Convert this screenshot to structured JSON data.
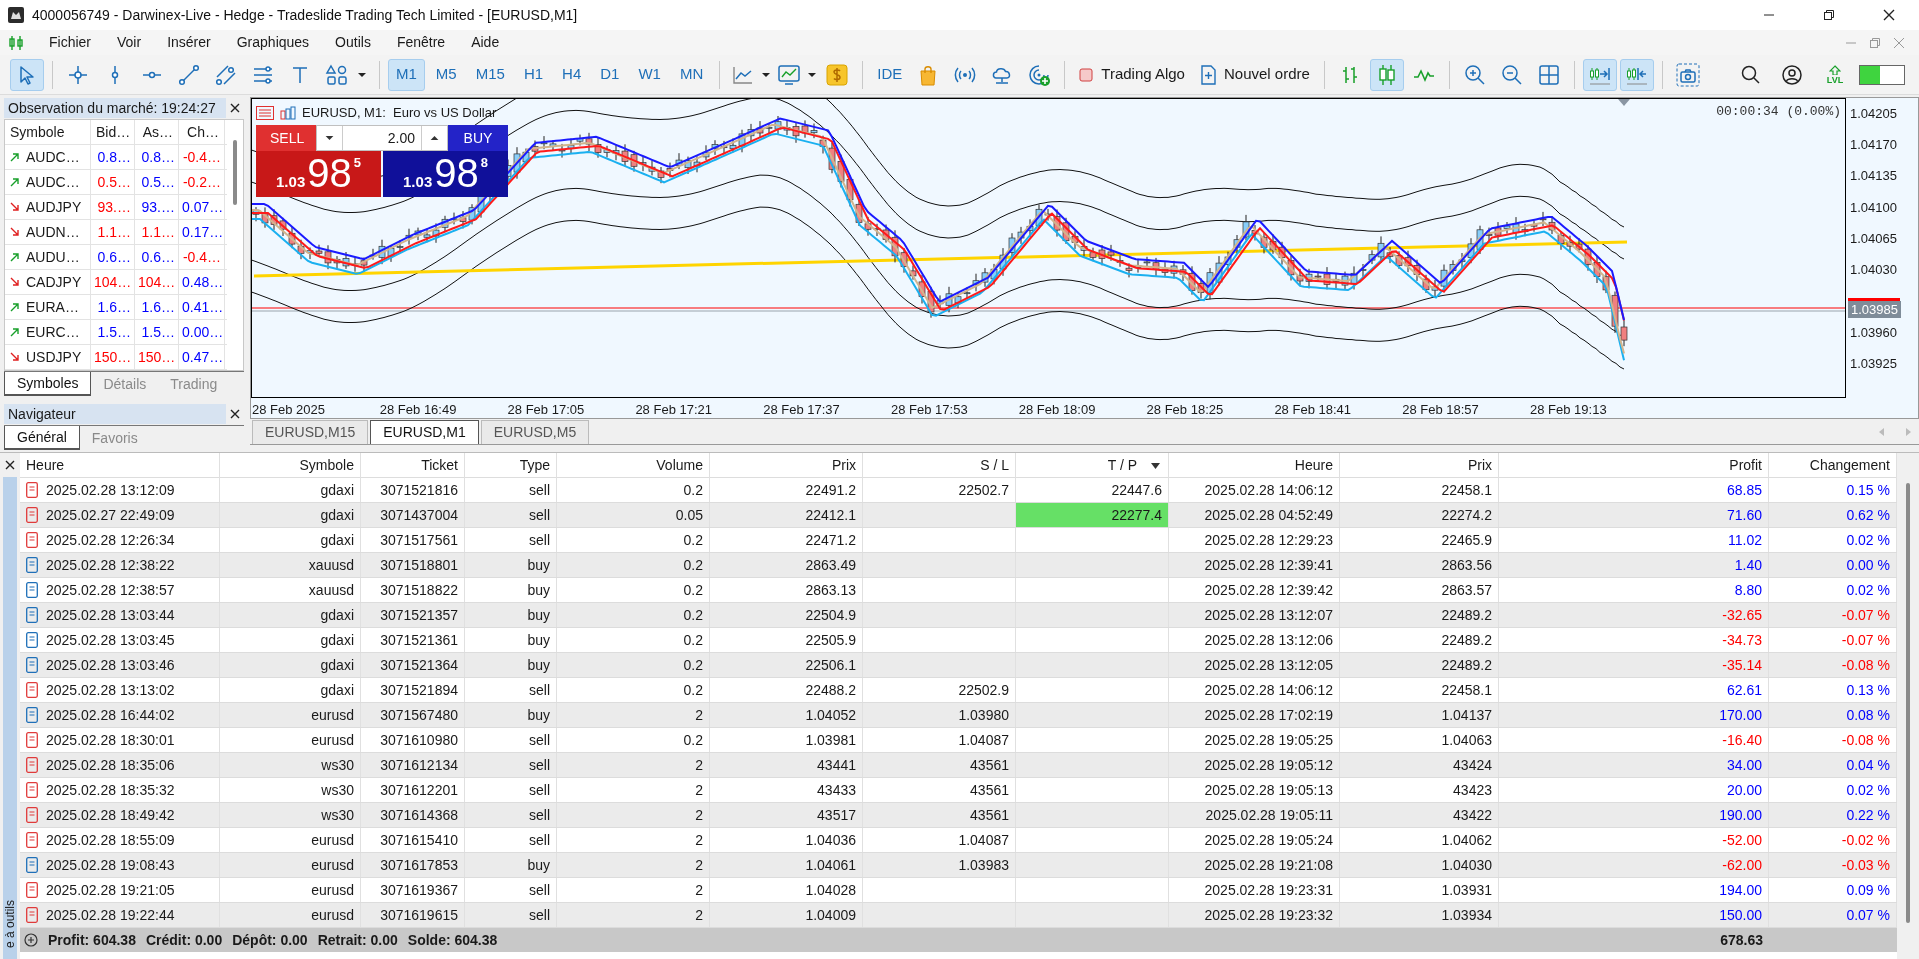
{
  "window": {
    "title": "4000056749 - Darwinex-Live - Hedge - Tradeslide Trading Tech Limited - [EURUSD,M1]"
  },
  "menu": [
    "Fichier",
    "Voir",
    "Insérer",
    "Graphiques",
    "Outils",
    "Fenêtre",
    "Aide"
  ],
  "toolbar": {
    "drawing_tools": [
      {
        "selected": true
      },
      {
        "selected": false
      },
      {
        "selected": false
      },
      {
        "selected": false
      },
      {
        "selected": false
      },
      {
        "selected": false
      },
      {
        "selected": false
      },
      {
        "selected": false
      },
      {
        "selected": false
      }
    ],
    "timeframes": [
      {
        "label": "M1",
        "selected": true
      },
      {
        "label": "M5",
        "selected": false
      },
      {
        "label": "M15",
        "selected": false
      },
      {
        "label": "H1",
        "selected": false
      },
      {
        "label": "H4",
        "selected": false
      },
      {
        "label": "D1",
        "selected": false
      },
      {
        "label": "W1",
        "selected": false
      },
      {
        "label": "MN",
        "selected": false
      }
    ],
    "ide_label": "IDE",
    "algo_trading": {
      "label": "Trading Algo",
      "on": false
    },
    "new_order_label": "Nouvel ordre",
    "chart_types": [
      {
        "selected": false
      },
      {
        "selected": true
      },
      {
        "selected": false
      }
    ],
    "chart_options": [
      {
        "selected": true
      },
      {
        "selected": true
      }
    ],
    "level_label": "LVL",
    "meter": {
      "level": 0.45
    }
  },
  "market_watch": {
    "title": "Observation du marché: 19:24:27",
    "columns": [
      "Symbole",
      "Bid…",
      "As…",
      "Ch…"
    ],
    "rows": [
      {
        "kind": "up",
        "symbol": "AUDC…",
        "bid": {
          "text": "0.8…",
          "color": "#0000ff"
        },
        "ask": {
          "text": "0.8…",
          "color": "#0000ff"
        },
        "change": {
          "text": "-0.4…",
          "color": "#ff0000"
        }
      },
      {
        "kind": "up",
        "symbol": "AUDC…",
        "bid": {
          "text": "0.5…",
          "color": "#ff0000"
        },
        "ask": {
          "text": "0.5…",
          "color": "#0000ff"
        },
        "change": {
          "text": "-0.2…",
          "color": "#ff0000"
        }
      },
      {
        "kind": "down",
        "symbol": "AUDJPY",
        "bid": {
          "text": "93.…",
          "color": "#ff0000"
        },
        "ask": {
          "text": "93.…",
          "color": "#0000ff"
        },
        "change": {
          "text": "0.07…",
          "color": "#0000ff"
        }
      },
      {
        "kind": "down",
        "symbol": "AUDN…",
        "bid": {
          "text": "1.1…",
          "color": "#ff0000"
        },
        "ask": {
          "text": "1.1…",
          "color": "#ff0000"
        },
        "change": {
          "text": "0.17…",
          "color": "#0000ff"
        }
      },
      {
        "kind": "up",
        "symbol": "AUDU…",
        "bid": {
          "text": "0.6…",
          "color": "#0000ff"
        },
        "ask": {
          "text": "0.6…",
          "color": "#0000ff"
        },
        "change": {
          "text": "-0.4…",
          "color": "#ff0000"
        }
      },
      {
        "kind": "down",
        "symbol": "CADJPY",
        "bid": {
          "text": "104…",
          "color": "#ff0000"
        },
        "ask": {
          "text": "104…",
          "color": "#ff0000"
        },
        "change": {
          "text": "0.48…",
          "color": "#0000ff"
        }
      },
      {
        "kind": "up",
        "symbol": "EURA…",
        "bid": {
          "text": "1.6…",
          "color": "#0000ff"
        },
        "ask": {
          "text": "1.6…",
          "color": "#0000ff"
        },
        "change": {
          "text": "0.41…",
          "color": "#0000ff"
        }
      },
      {
        "kind": "up",
        "symbol": "EURC…",
        "bid": {
          "text": "1.5…",
          "color": "#0000ff"
        },
        "ask": {
          "text": "1.5…",
          "color": "#0000ff"
        },
        "change": {
          "text": "0.00…",
          "color": "#0000ff"
        }
      },
      {
        "kind": "down",
        "symbol": "USDJPY",
        "bid": {
          "text": "150…",
          "color": "#ff0000"
        },
        "ask": {
          "text": "150…",
          "color": "#ff0000"
        },
        "change": {
          "text": "0.47…",
          "color": "#0000ff"
        }
      }
    ],
    "tabs": [
      {
        "label": "Symboles",
        "selected": true
      },
      {
        "label": "Détails",
        "selected": false
      },
      {
        "label": "Trading",
        "selected": false
      }
    ]
  },
  "navigator": {
    "title": "Navigateur",
    "tabs": [
      {
        "label": "Général",
        "selected": true
      },
      {
        "label": "Favoris",
        "selected": false
      }
    ]
  },
  "chart": {
    "header": "EURUSD, M1:  Euro vs US Dollar",
    "one_click": {
      "sell_label": "SELL",
      "buy_label": "BUY",
      "volume": "2.00",
      "sell_price": {
        "prefix": "1.03",
        "main": "98",
        "suffix": "5"
      },
      "buy_price": {
        "prefix": "1.03",
        "main": "98",
        "suffix": "8"
      }
    },
    "timer": "00:00:34 (0.00%)",
    "price_labels": [
      "1.04205",
      "1.04170",
      "1.04135",
      "1.04100",
      "1.04065",
      "1.04030",
      "1.03960",
      "1.03925"
    ],
    "current_price": "1.03985",
    "time_labels": [
      "28 Feb 2025",
      "28 Feb 16:49",
      "28 Feb 17:05",
      "28 Feb 17:21",
      "28 Feb 17:37",
      "28 Feb 17:53",
      "28 Feb 18:09",
      "28 Feb 18:25",
      "28 Feb 18:41",
      "28 Feb 18:57",
      "28 Feb 19:13"
    ]
  },
  "chart_tabs": [
    {
      "label": "EURUSD,M15",
      "selected": false
    },
    {
      "label": "EURUSD,M1",
      "selected": true
    },
    {
      "label": "EURUSD,M5",
      "selected": false
    }
  ],
  "table": {
    "columns": [
      {
        "label": "Heure",
        "sorted": false
      },
      {
        "label": "Symbole",
        "sorted": false
      },
      {
        "label": "Ticket",
        "sorted": false
      },
      {
        "label": "Type",
        "sorted": false
      },
      {
        "label": "Volume",
        "sorted": false
      },
      {
        "label": "Prix",
        "sorted": false
      },
      {
        "label": "S / L",
        "sorted": false
      },
      {
        "label": "T / P",
        "sorted": true
      },
      {
        "label": "Heure",
        "sorted": false
      },
      {
        "label": "Prix",
        "sorted": false
      },
      {
        "label": "Profit",
        "sorted": false
      },
      {
        "label": "Changement",
        "sorted": false
      }
    ],
    "rows": [
      {
        "kind": "sell",
        "open_time": "2025.02.28 13:12:09",
        "symbol": "gdaxi",
        "ticket": "3071521816",
        "type": "sell",
        "volume": "0.2",
        "open_price": "22491.2",
        "sl": "22502.7",
        "tp": "22447.6",
        "tp_hit": false,
        "close_time": "2025.02.28 14:06:12",
        "close_price": "22458.1",
        "profit": "68.85",
        "change": "0.15 %",
        "color": "#0000ff"
      },
      {
        "kind": "sell",
        "open_time": "2025.02.27 22:49:09",
        "symbol": "gdaxi",
        "ticket": "3071437004",
        "type": "sell",
        "volume": "0.05",
        "open_price": "22412.1",
        "tp": "22277.4",
        "tp_hit": true,
        "close_time": "2025.02.28 04:52:49",
        "close_price": "22274.2",
        "profit": "71.60",
        "change": "0.62 %",
        "color": "#0000ff"
      },
      {
        "kind": "sell",
        "open_time": "2025.02.28 12:26:34",
        "symbol": "gdaxi",
        "ticket": "3071517561",
        "type": "sell",
        "volume": "0.2",
        "open_price": "22471.2",
        "tp_hit": false,
        "close_time": "2025.02.28 12:29:23",
        "close_price": "22465.9",
        "profit": "11.02",
        "change": "0.02 %",
        "color": "#0000ff"
      },
      {
        "kind": "buy",
        "open_time": "2025.02.28 12:38:22",
        "symbol": "xauusd",
        "ticket": "3071518801",
        "type": "buy",
        "volume": "0.2",
        "open_price": "2863.49",
        "tp_hit": false,
        "close_time": "2025.02.28 12:39:41",
        "close_price": "2863.56",
        "profit": "1.40",
        "change": "0.00 %",
        "color": "#0000ff"
      },
      {
        "kind": "buy",
        "open_time": "2025.02.28 12:38:57",
        "symbol": "xauusd",
        "ticket": "3071518822",
        "type": "buy",
        "volume": "0.2",
        "open_price": "2863.13",
        "tp_hit": false,
        "close_time": "2025.02.28 12:39:42",
        "close_price": "2863.57",
        "profit": "8.80",
        "change": "0.02 %",
        "color": "#0000ff"
      },
      {
        "kind": "buy",
        "open_time": "2025.02.28 13:03:44",
        "symbol": "gdaxi",
        "ticket": "3071521357",
        "type": "buy",
        "volume": "0.2",
        "open_price": "22504.9",
        "tp_hit": false,
        "close_time": "2025.02.28 13:12:07",
        "close_price": "22489.2",
        "profit": "-32.65",
        "change": "-0.07 %",
        "color": "#ff0000"
      },
      {
        "kind": "buy",
        "open_time": "2025.02.28 13:03:45",
        "symbol": "gdaxi",
        "ticket": "3071521361",
        "type": "buy",
        "volume": "0.2",
        "open_price": "22505.9",
        "tp_hit": false,
        "close_time": "2025.02.28 13:12:06",
        "close_price": "22489.2",
        "profit": "-34.73",
        "change": "-0.07 %",
        "color": "#ff0000"
      },
      {
        "kind": "buy",
        "open_time": "2025.02.28 13:03:46",
        "symbol": "gdaxi",
        "ticket": "3071521364",
        "type": "buy",
        "volume": "0.2",
        "open_price": "22506.1",
        "tp_hit": false,
        "close_time": "2025.02.28 13:12:05",
        "close_price": "22489.2",
        "profit": "-35.14",
        "change": "-0.08 %",
        "color": "#ff0000"
      },
      {
        "kind": "sell",
        "open_time": "2025.02.28 13:13:02",
        "symbol": "gdaxi",
        "ticket": "3071521894",
        "type": "sell",
        "volume": "0.2",
        "open_price": "22488.2",
        "sl": "22502.9",
        "tp_hit": false,
        "close_time": "2025.02.28 14:06:12",
        "close_price": "22458.1",
        "profit": "62.61",
        "change": "0.13 %",
        "color": "#0000ff"
      },
      {
        "kind": "buy",
        "open_time": "2025.02.28 16:44:02",
        "symbol": "eurusd",
        "ticket": "3071567480",
        "type": "buy",
        "volume": "2",
        "open_price": "1.04052",
        "sl": "1.03980",
        "tp_hit": false,
        "close_time": "2025.02.28 17:02:19",
        "close_price": "1.04137",
        "profit": "170.00",
        "change": "0.08 %",
        "color": "#0000ff"
      },
      {
        "kind": "sell",
        "open_time": "2025.02.28 18:30:01",
        "symbol": "eurusd",
        "ticket": "3071610980",
        "type": "sell",
        "volume": "0.2",
        "open_price": "1.03981",
        "sl": "1.04087",
        "tp_hit": false,
        "close_time": "2025.02.28 19:05:25",
        "close_price": "1.04063",
        "profit": "-16.40",
        "change": "-0.08 %",
        "color": "#ff0000"
      },
      {
        "kind": "sell",
        "open_time": "2025.02.28 18:35:06",
        "symbol": "ws30",
        "ticket": "3071612134",
        "type": "sell",
        "volume": "2",
        "open_price": "43441",
        "sl": "43561",
        "tp_hit": false,
        "close_time": "2025.02.28 19:05:12",
        "close_price": "43424",
        "profit": "34.00",
        "change": "0.04 %",
        "color": "#0000ff"
      },
      {
        "kind": "sell",
        "open_time": "2025.02.28 18:35:32",
        "symbol": "ws30",
        "ticket": "3071612201",
        "type": "sell",
        "volume": "2",
        "open_price": "43433",
        "sl": "43561",
        "tp_hit": false,
        "close_time": "2025.02.28 19:05:13",
        "close_price": "43423",
        "profit": "20.00",
        "change": "0.02 %",
        "color": "#0000ff"
      },
      {
        "kind": "sell",
        "open_time": "2025.02.28 18:49:42",
        "symbol": "ws30",
        "ticket": "3071614368",
        "type": "sell",
        "volume": "2",
        "open_price": "43517",
        "sl": "43561",
        "tp_hit": false,
        "close_time": "2025.02.28 19:05:11",
        "close_price": "43422",
        "profit": "190.00",
        "change": "0.22 %",
        "color": "#0000ff"
      },
      {
        "kind": "sell",
        "open_time": "2025.02.28 18:55:09",
        "symbol": "eurusd",
        "ticket": "3071615410",
        "type": "sell",
        "volume": "2",
        "open_price": "1.04036",
        "sl": "1.04087",
        "tp_hit": false,
        "close_time": "2025.02.28 19:05:24",
        "close_price": "1.04062",
        "profit": "-52.00",
        "change": "-0.02 %",
        "color": "#ff0000"
      },
      {
        "kind": "buy",
        "open_time": "2025.02.28 19:08:43",
        "symbol": "eurusd",
        "ticket": "3071617853",
        "type": "buy",
        "volume": "2",
        "open_price": "1.04061",
        "sl": "1.03983",
        "tp_hit": false,
        "close_time": "2025.02.28 19:21:08",
        "close_price": "1.04030",
        "profit": "-62.00",
        "change": "-0.03 %",
        "color": "#ff0000"
      },
      {
        "kind": "sell",
        "open_time": "2025.02.28 19:21:05",
        "symbol": "eurusd",
        "ticket": "3071619367",
        "type": "sell",
        "volume": "2",
        "open_price": "1.04028",
        "tp_hit": false,
        "close_time": "2025.02.28 19:23:31",
        "close_price": "1.03931",
        "profit": "194.00",
        "change": "0.09 %",
        "color": "#0000ff"
      },
      {
        "kind": "sell",
        "open_time": "2025.02.28 19:22:44",
        "symbol": "eurusd",
        "ticket": "3071619615",
        "type": "sell",
        "volume": "2",
        "open_price": "1.04009",
        "tp_hit": false,
        "close_time": "2025.02.28 19:23:32",
        "close_price": "1.03934",
        "profit": "150.00",
        "change": "0.07 %",
        "color": "#0000ff"
      }
    ],
    "summary": [
      "Profit: 604.38",
      "Crédit: 0.00",
      "Dépôt: 0.00",
      "Retrait: 0.00",
      "Solde: 604.38"
    ],
    "total_profit": "678.63"
  },
  "toolbox_label": "e à outils"
}
